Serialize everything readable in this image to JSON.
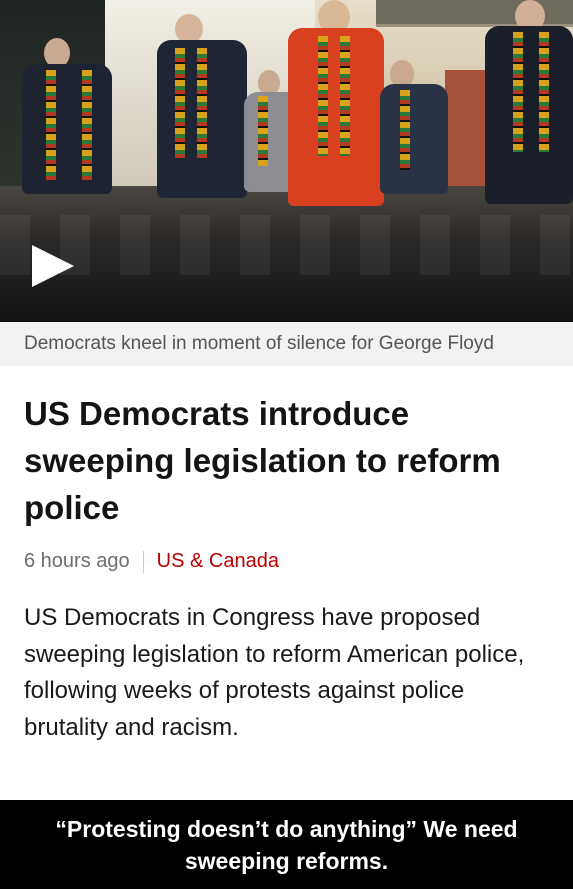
{
  "video": {
    "caption": "Democrats kneel in moment of silence for George Floyd",
    "play_icon": "play-icon"
  },
  "article": {
    "headline": "US Democrats introduce sweeping legislation to reform police",
    "timestamp": "6 hours ago",
    "section": "US & Canada",
    "summary": "US Democrats in Congress have proposed sweeping legislation to reform American police, following weeks of protests against police brutality and racism."
  },
  "overlay": {
    "caption": "“Protesting doesn’t do anything” We need sweeping reforms."
  },
  "colors": {
    "section_link": "#b80000",
    "caption_bar_bg": "#f2f2f2",
    "meme_bar_bg": "#000000"
  }
}
